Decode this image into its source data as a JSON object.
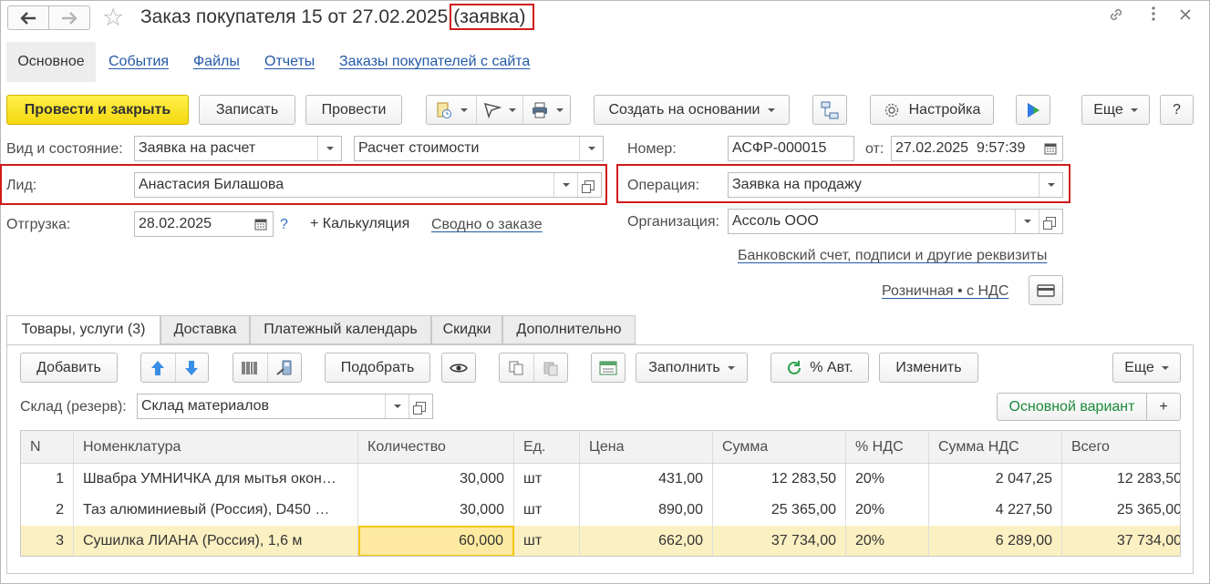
{
  "window": {
    "title": "Заказ покупателя 15 от 27.02.2025",
    "title_suffix": "(заявка)",
    "icons": [
      "link-icon",
      "more-vertical-icon",
      "close-icon"
    ]
  },
  "page_tabs": [
    {
      "label": "Основное",
      "active": true
    },
    {
      "label": "События"
    },
    {
      "label": "Файлы"
    },
    {
      "label": "Отчеты"
    },
    {
      "label": "Заказы покупателей с сайта"
    }
  ],
  "toolbar": {
    "post_close": "Провести и закрыть",
    "save": "Записать",
    "post": "Провести",
    "create_based_on": "Создать на основании",
    "settings": "Настройка",
    "more": "Еще",
    "help": "?"
  },
  "form": {
    "kind_label": "Вид и состояние:",
    "kind_value": "Заявка на расчет",
    "state_value": "Расчет стоимости",
    "number_label": "Номер:",
    "number_value": "АСФР-000015",
    "date_label": "от:",
    "date_value": "27.02.2025  9:57:39",
    "lead_label": "Лид:",
    "lead_value": "Анастасия Билашова",
    "operation_label": "Операция:",
    "operation_value": "Заявка на продажу",
    "shipment_label": "Отгрузка:",
    "shipment_value": "28.02.2025",
    "help_q": "?",
    "calc_link": "+ Калькуляция",
    "summary_link": "Сводно о заказе",
    "org_label": "Организация:",
    "org_value": "Ассоль ООО",
    "bank_link": "Банковский счет, подписи и другие реквизиты",
    "price_link": "Розничная • с НДС"
  },
  "inner_tabs": [
    {
      "label": "Товары, услуги (3)",
      "active": true
    },
    {
      "label": "Доставка"
    },
    {
      "label": "Платежный календарь"
    },
    {
      "label": "Скидки"
    },
    {
      "label": "Дополнительно"
    }
  ],
  "goods_toolbar": {
    "add": "Добавить",
    "pick": "Подобрать",
    "fill": "Заполнить",
    "auto_pct": "% Авт.",
    "change": "Изменить",
    "more": "Еще"
  },
  "warehouse": {
    "label": "Склад (резерв):",
    "value": "Склад материалов",
    "variant": "Основной вариант",
    "plus": "+"
  },
  "table": {
    "columns": [
      "N",
      "Номенклатура",
      "Количество",
      "Ед.",
      "Цена",
      "Сумма",
      "% НДС",
      "Сумма НДС",
      "Всего"
    ],
    "rows": [
      [
        "1",
        "Швабра УМНИЧКА для мытья окон…",
        "30,000",
        "шт",
        "431,00",
        "12 283,50",
        "20%",
        "2 047,25",
        "12 283,50"
      ],
      [
        "2",
        "Таз алюминиевый (Россия), D450 …",
        "30,000",
        "шт",
        "890,00",
        "25 365,00",
        "20%",
        "4 227,50",
        "25 365,00"
      ],
      [
        "3",
        "Сушилка ЛИАНА (Россия), 1,6 м",
        "60,000",
        "шт",
        "662,00",
        "37 734,00",
        "20%",
        "6 289,00",
        "37 734,00"
      ]
    ],
    "selected_row": 3
  },
  "colors": {
    "accent_yellow": "#f4d80f",
    "highlight_red": "#d01a1a",
    "link_blue": "#235aa6",
    "selected_row": "#fbf0c2",
    "green_text": "#1a8a3a"
  }
}
